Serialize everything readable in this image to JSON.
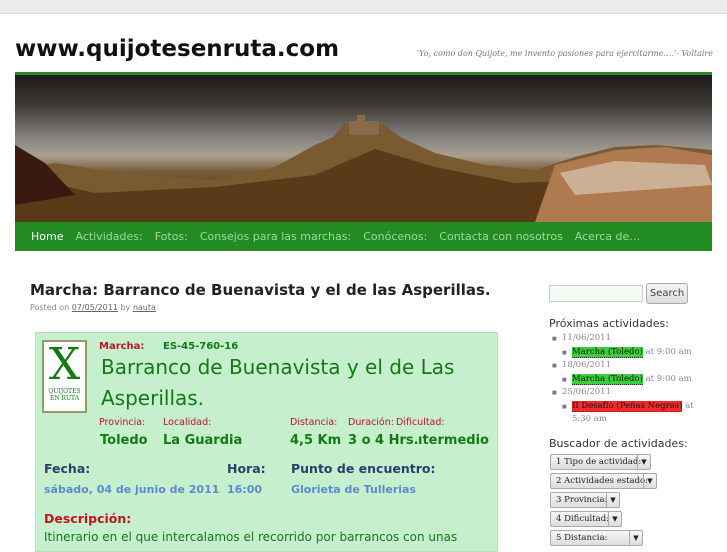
{
  "site": {
    "title": "www.quijotesenruta.com",
    "tagline": "'Yo, como don Quijote, me invento pasiones para ejercitarme….'- Voltaire"
  },
  "nav": [
    "Home",
    "Actividades:",
    "Fotos:",
    "Consejos para las marchas:",
    "Conócenos:",
    "Contacta con nosotros",
    "Acerca de…"
  ],
  "post": {
    "title": "Marcha: Barranco de Buenavista y el de las Asperillas.",
    "posted_on": "Posted on",
    "date": "07/05/2011",
    "by": "by",
    "author": "nauta"
  },
  "card": {
    "logo": {
      "x": "X",
      "line1": "QUIJOTES",
      "line2": "EN RUTA"
    },
    "marcha_label": "Marcha:",
    "code": "ES-45-760-16",
    "name_line1": "Barranco de Buenavista y el de Las",
    "name_line2": "Asperillas.",
    "provincia_label": "Provincia:",
    "provincia": "Toledo",
    "localidad_label": "Localidad:",
    "localidad": "La Guardia",
    "distancia_label": "Distancia:",
    "distancia": "4,5 Km",
    "duracion_label": "Duración:",
    "duracion": "3 o 4 Hrs.",
    "dificultad_label": "Dificultad:",
    "dificultad": "ıtermedio",
    "fecha_label": "Fecha:",
    "fecha": "sábado, 04 de junio de 2011",
    "hora_label": "Hora:",
    "hora": "16:00",
    "punto_label": "Punto de encuentro:",
    "punto": "Glorieta de Tullerias",
    "descripcion_label": "Descripción:",
    "descripcion": "Itinerario en el que intercalamos el recorrido por barrancos con unas"
  },
  "sidebar": {
    "search_button": "Search",
    "proximas_title": "Próximas actividades:",
    "events": [
      {
        "date": "11/06/2011",
        "name": "Marcha (Toledo)",
        "time": "at 9:00 am",
        "color": "green"
      },
      {
        "date": "18/06/2011",
        "name": "Marcha (Toledo)",
        "time": "at 9:00 am",
        "color": "green"
      },
      {
        "date": "25/06/2011",
        "name": "II Desafío (Peñas Negras)",
        "time": "at 5:30 am",
        "color": "red"
      }
    ],
    "buscador_title": "Buscador de actividades:",
    "filters": [
      "1 Tipo de actividad:",
      "2 Actividades estado:",
      "3 Provincia:",
      "4 Dificultad:",
      "5 Distancia:"
    ]
  }
}
